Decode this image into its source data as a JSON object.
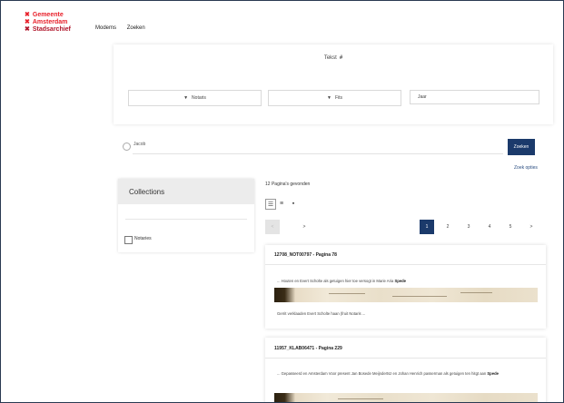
{
  "header": {
    "logo_lines": [
      "Gemeente",
      "Amsterdam",
      "Stadsarchief"
    ],
    "nav": [
      "Modems",
      "Zoeken"
    ]
  },
  "search_panel": {
    "title": "Tekst",
    "title_icon": "bullet-icon",
    "filters": [
      {
        "label": "Notaris",
        "icon": "funnel-icon"
      },
      {
        "label": "Fits",
        "icon": "funnel-icon"
      },
      {
        "label": "Jaar",
        "icon": ""
      }
    ]
  },
  "query": {
    "value": "Jacob",
    "button_label": "Zoeken",
    "options_link": "Zoek opties"
  },
  "collections": {
    "title": "Collections",
    "items": [
      {
        "label": "Notaries",
        "checked": false
      }
    ]
  },
  "results": {
    "count_text": "12 Pagina's gevonden",
    "view_icons": [
      "list-view-icon",
      "sort-icon",
      "grid-view-icon"
    ],
    "pagination": {
      "prev": "<",
      "prev2": ">",
      "pages": [
        "1",
        "2",
        "3",
        "4",
        "5"
      ],
      "next": ">",
      "active_page": "1"
    },
    "items": [
      {
        "title": "12708_NOT00797 - Pagina 78",
        "snippet_before": "... Houten en Evert Scholte als getuigen hier toe versogt in Marie Aria",
        "snippet_highlight": "Spede",
        "snippet_after": "",
        "snippet2": "Gerrit verklaaden Evert Scholte haan (fruit Notaris ..."
      },
      {
        "title": "11957_KLAB06471 - Pagina 229",
        "snippet_before": "... Gepasseerd en Amsterdam Voor present Jan Bosede Meijndertsz en Johan Henrich passerman als getuigen ten hitgt aan",
        "snippet_highlight": "Spede",
        "snippet_after": "",
        "snippet2": ""
      }
    ]
  },
  "colors": {
    "accent": "#1b3a6b",
    "logo_red": "#e8202a"
  }
}
